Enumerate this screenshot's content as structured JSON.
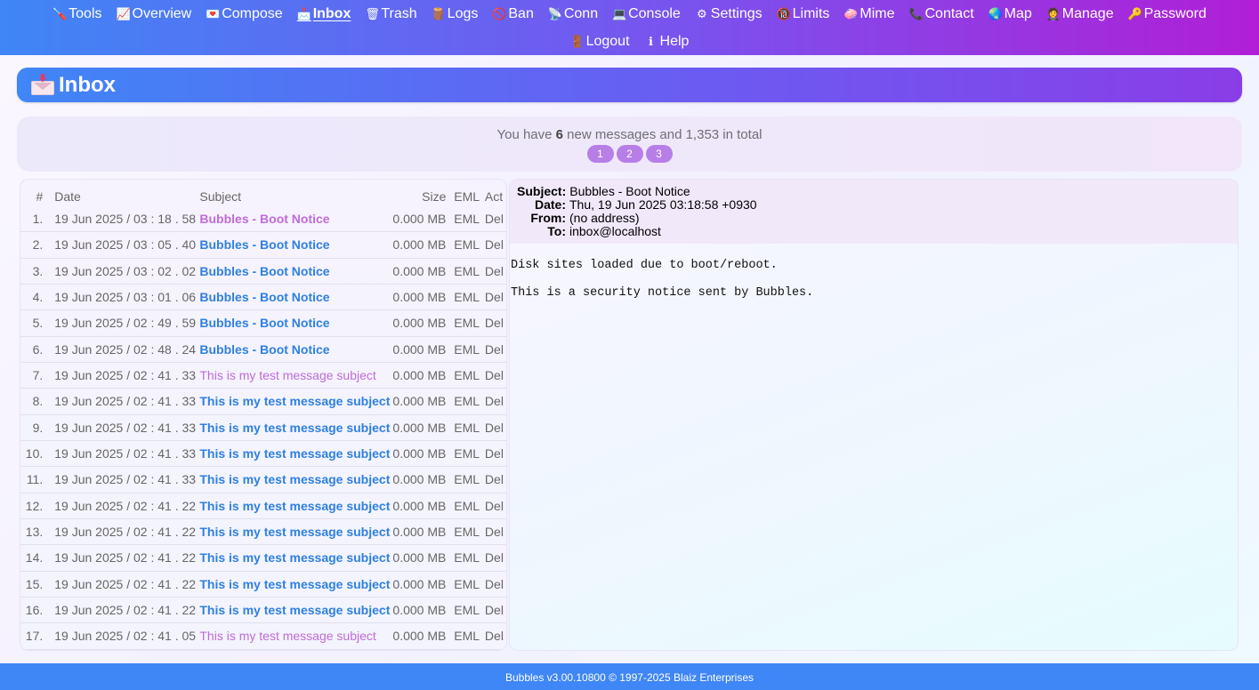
{
  "nav": {
    "row1": [
      {
        "label": "Tools",
        "icon": "tools-icon",
        "glyph": "🪛"
      },
      {
        "label": "Overview",
        "icon": "chart-icon",
        "glyph": "📈"
      },
      {
        "label": "Compose",
        "icon": "compose-icon",
        "glyph": "💌"
      },
      {
        "label": "Inbox",
        "icon": "inbox-icon",
        "glyph": "📩"
      },
      {
        "label": "Trash",
        "icon": "trash-icon",
        "glyph": "🗑"
      },
      {
        "label": "Logs",
        "icon": "logs-icon",
        "glyph": "🪵"
      },
      {
        "label": "Ban",
        "icon": "ban-icon",
        "glyph": "🚫"
      },
      {
        "label": "Conn",
        "icon": "satellite-icon",
        "glyph": "📡"
      },
      {
        "label": "Console",
        "icon": "laptop-icon",
        "glyph": "💻"
      },
      {
        "label": "Settings",
        "icon": "gear-icon",
        "glyph": "⚙"
      },
      {
        "label": "Limits",
        "icon": "no-entry-icon",
        "glyph": "🔞"
      },
      {
        "label": "Mime",
        "icon": "mime-icon",
        "glyph": "🧼"
      },
      {
        "label": "Contact",
        "icon": "phone-icon",
        "glyph": "📞"
      },
      {
        "label": "Map",
        "icon": "globe-icon",
        "glyph": "🌏"
      },
      {
        "label": "Manage",
        "icon": "person-icon",
        "glyph": "🤵"
      },
      {
        "label": "Password",
        "icon": "key-icon",
        "glyph": "🔑"
      }
    ],
    "row2": [
      {
        "label": "Logout",
        "icon": "door-icon",
        "glyph": "🚪"
      },
      {
        "label": "Help",
        "icon": "info-icon",
        "glyph": "ℹ"
      }
    ],
    "active": "Inbox"
  },
  "page_title": "Inbox",
  "summary": {
    "prefix": "You have ",
    "new_count": "6",
    "suffix": " new messages and 1,353 in total",
    "pages": [
      "1",
      "2",
      "3"
    ]
  },
  "table": {
    "headers": {
      "num": "#",
      "date": "Date",
      "subject": "Subject",
      "size": "Size",
      "eml": "EML",
      "act": "Act"
    },
    "rows": [
      {
        "num": "1.",
        "date": "19 Jun 2025 / 03 : 18 . 58",
        "subject": "Bubbles - Boot Notice",
        "state": "selected",
        "size": "0.000 MB",
        "eml": "EML",
        "act": "Del"
      },
      {
        "num": "2.",
        "date": "19 Jun 2025 / 03 : 05 . 40",
        "subject": "Bubbles - Boot Notice",
        "state": "new",
        "size": "0.000 MB",
        "eml": "EML",
        "act": "Del"
      },
      {
        "num": "3.",
        "date": "19 Jun 2025 / 03 : 02 . 02",
        "subject": "Bubbles - Boot Notice",
        "state": "new",
        "size": "0.000 MB",
        "eml": "EML",
        "act": "Del"
      },
      {
        "num": "4.",
        "date": "19 Jun 2025 / 03 : 01 . 06",
        "subject": "Bubbles - Boot Notice",
        "state": "new",
        "size": "0.000 MB",
        "eml": "EML",
        "act": "Del"
      },
      {
        "num": "5.",
        "date": "19 Jun 2025 / 02 : 49 . 59",
        "subject": "Bubbles - Boot Notice",
        "state": "new",
        "size": "0.000 MB",
        "eml": "EML",
        "act": "Del"
      },
      {
        "num": "6.",
        "date": "19 Jun 2025 / 02 : 48 . 24",
        "subject": "Bubbles - Boot Notice",
        "state": "new",
        "size": "0.000 MB",
        "eml": "EML",
        "act": "Del"
      },
      {
        "num": "7.",
        "date": "19 Jun 2025 / 02 : 41 . 33",
        "subject": "This is my test message subject",
        "state": "read",
        "size": "0.000 MB",
        "eml": "EML",
        "act": "Del"
      },
      {
        "num": "8.",
        "date": "19 Jun 2025 / 02 : 41 . 33",
        "subject": "This is my test message subject",
        "state": "new",
        "size": "0.000 MB",
        "eml": "EML",
        "act": "Del"
      },
      {
        "num": "9.",
        "date": "19 Jun 2025 / 02 : 41 . 33",
        "subject": "This is my test message subject",
        "state": "new",
        "size": "0.000 MB",
        "eml": "EML",
        "act": "Del"
      },
      {
        "num": "10.",
        "date": "19 Jun 2025 / 02 : 41 . 33",
        "subject": "This is my test message subject",
        "state": "new",
        "size": "0.000 MB",
        "eml": "EML",
        "act": "Del"
      },
      {
        "num": "11.",
        "date": "19 Jun 2025 / 02 : 41 . 33",
        "subject": "This is my test message subject",
        "state": "new",
        "size": "0.000 MB",
        "eml": "EML",
        "act": "Del"
      },
      {
        "num": "12.",
        "date": "19 Jun 2025 / 02 : 41 . 22",
        "subject": "This is my test message subject",
        "state": "new",
        "size": "0.000 MB",
        "eml": "EML",
        "act": "Del"
      },
      {
        "num": "13.",
        "date": "19 Jun 2025 / 02 : 41 . 22",
        "subject": "This is my test message subject",
        "state": "new",
        "size": "0.000 MB",
        "eml": "EML",
        "act": "Del"
      },
      {
        "num": "14.",
        "date": "19 Jun 2025 / 02 : 41 . 22",
        "subject": "This is my test message subject",
        "state": "new",
        "size": "0.000 MB",
        "eml": "EML",
        "act": "Del"
      },
      {
        "num": "15.",
        "date": "19 Jun 2025 / 02 : 41 . 22",
        "subject": "This is my test message subject",
        "state": "new",
        "size": "0.000 MB",
        "eml": "EML",
        "act": "Del"
      },
      {
        "num": "16.",
        "date": "19 Jun 2025 / 02 : 41 . 22",
        "subject": "This is my test message subject",
        "state": "new",
        "size": "0.000 MB",
        "eml": "EML",
        "act": "Del"
      },
      {
        "num": "17.",
        "date": "19 Jun 2025 / 02 : 41 . 05",
        "subject": "This is my test message subject",
        "state": "read",
        "size": "0.000 MB",
        "eml": "EML",
        "act": "Del"
      }
    ]
  },
  "preview": {
    "subject_label": "Subject:",
    "subject": "Bubbles - Boot Notice",
    "date_label": "Date:",
    "date": "Thu, 19 Jun 2025 03:18:58 +0930",
    "from_label": "From:",
    "from": "(no address)",
    "to_label": "To:",
    "to": "inbox@localhost",
    "body": [
      "Disk sites loaded due to boot/reboot.",
      "This is a security notice sent by Bubbles."
    ]
  },
  "footer": "Bubbles v3.00.10800 © 1997-2025 Blaiz Enterprises",
  "colors": {
    "nav_gradient_start": "#3f86f6",
    "nav_gradient_end": "#b01fd6",
    "link": "#2f80e0",
    "read_subject": "#c06bd8",
    "page_button": "#b77ee8",
    "footer": "#3f86f6"
  }
}
